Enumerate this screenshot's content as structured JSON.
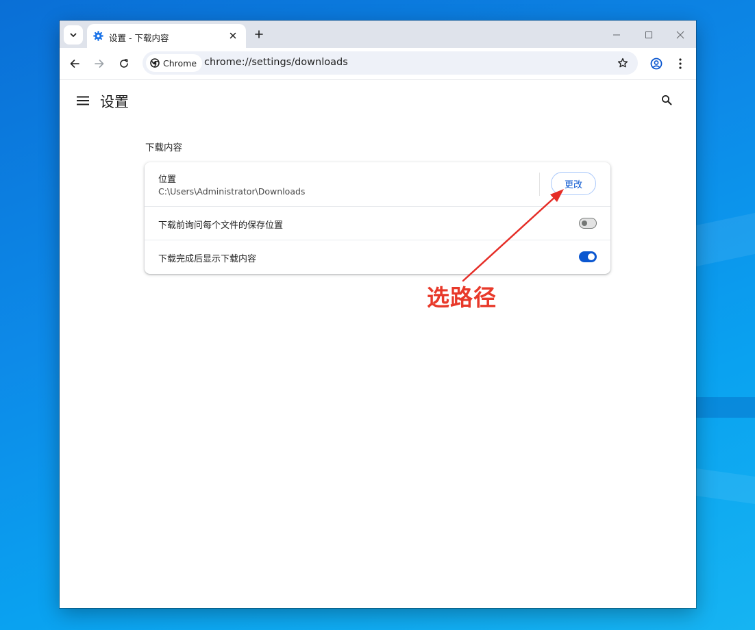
{
  "browser": {
    "tab": {
      "title": "设置 - 下载内容",
      "favicon": "gear-icon"
    },
    "omnibox": {
      "chip_label": "Chrome",
      "url": "chrome://settings/downloads"
    }
  },
  "settings": {
    "header_title": "设置",
    "section_title": "下载内容",
    "location": {
      "label": "位置",
      "path": "C:\\Users\\Administrator\\Downloads",
      "change_button": "更改"
    },
    "ask_where_to_save": {
      "label": "下载前询问每个文件的保存位置",
      "enabled": false
    },
    "show_when_complete": {
      "label": "下载完成后显示下载内容",
      "enabled": true
    }
  },
  "annotation": {
    "text": "选路径",
    "color": "#e8392a"
  },
  "colors": {
    "accent": "#0b57d0",
    "tabstrip": "#dfe3eb",
    "desktop": "#0d8ae8"
  }
}
